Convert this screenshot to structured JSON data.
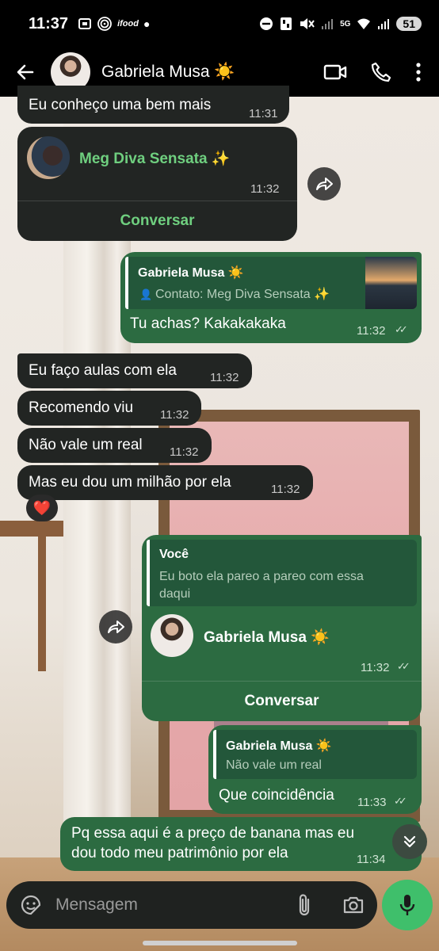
{
  "status_bar": {
    "time": "11:37",
    "left_icons": [
      "screenshot-icon",
      "fingerprint-icon",
      "ifood-icon",
      "dot"
    ],
    "ifood_text": "ifood",
    "signal_label": "5G",
    "battery": "51"
  },
  "header": {
    "contact_name": "Gabriela Musa ☀️"
  },
  "messages": [
    {
      "text": "Eu conheço uma bem mais",
      "time": "11:31"
    },
    {
      "contact_name": "Meg Diva Sensata ✨",
      "time": "11:32",
      "action": "Conversar"
    },
    {
      "quote_title": "Gabriela Musa ☀️",
      "quote_sub": "Contato: Meg Diva Sensata ✨",
      "text": "Tu achas? Kakakakaka",
      "time": "11:32"
    },
    {
      "text": "Eu faço aulas com ela",
      "time": "11:32"
    },
    {
      "text": "Recomendo viu",
      "time": "11:32"
    },
    {
      "text": "Não vale um real",
      "time": "11:32"
    },
    {
      "text": "Mas eu dou um milhão por ela",
      "time": "11:32",
      "reaction": "❤️"
    },
    {
      "quote_title": "Você",
      "quote_line1": "Eu boto ela pareo a pareo com essa",
      "quote_line2": "daqui",
      "contact_name": "Gabriela Musa ☀️",
      "time": "11:32",
      "action": "Conversar"
    },
    {
      "quote_title": "Gabriela Musa ☀️",
      "quote_sub": "Não vale um real",
      "text": "Que coincidência",
      "time": "11:33"
    },
    {
      "line1": "Pq essa aqui é a preço de banana mas eu",
      "line2": "dou todo meu patrimônio por ela",
      "time": "11:34"
    }
  ],
  "composer": {
    "placeholder": "Mensagem"
  },
  "colors": {
    "incoming_bubble": "#222523",
    "outgoing_bubble": "#2c6b41",
    "accent_green": "#6fcf7f",
    "mic_button": "#3fbf6b"
  }
}
